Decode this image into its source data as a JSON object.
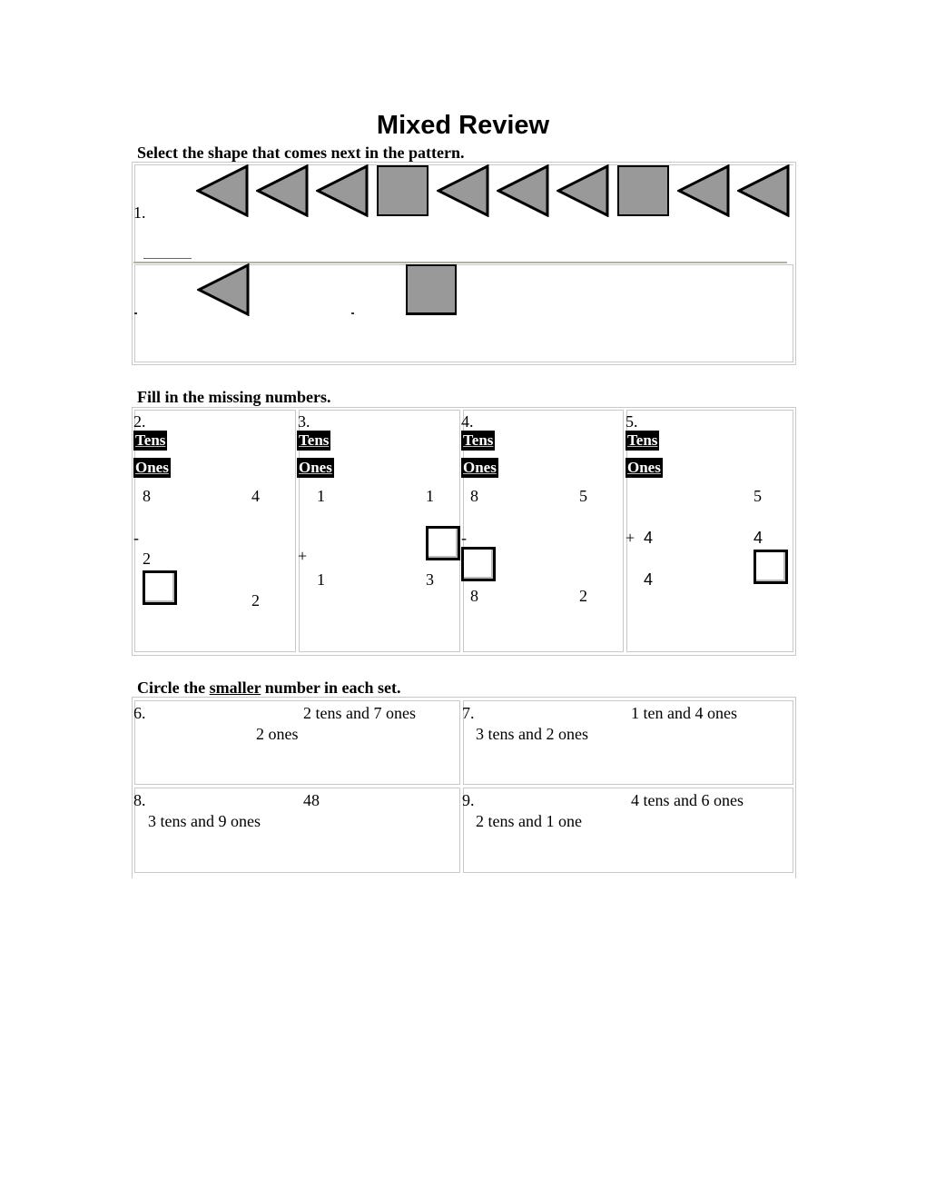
{
  "title": "Mixed Review",
  "sections": {
    "pattern": {
      "instruction": "Select the shape that comes next in the pattern.",
      "problem_number": "1.",
      "pattern_shapes": [
        "triangle-left-icon",
        "triangle-left-icon",
        "triangle-left-icon",
        "square-icon",
        "triangle-left-icon",
        "triangle-left-icon",
        "triangle-left-icon",
        "square-icon",
        "triangle-left-icon",
        "triangle-left-icon"
      ],
      "answer_blank": "",
      "choices": [
        "triangle-left-icon",
        "square-icon"
      ],
      "colors": {
        "shape_fill": "#999999",
        "shape_stroke": "#000000"
      }
    },
    "missing_numbers": {
      "instruction": "Fill in the missing numbers.",
      "tens_label": "Tens",
      "ones_label": "Ones",
      "problems": [
        {
          "number": "2.",
          "top_tens": "8",
          "top_ones": "4",
          "operator": "-",
          "second_tens": "2",
          "second_ones": "",
          "result_tens": "",
          "result_ones": "2"
        },
        {
          "number": "3.",
          "top_tens": "1",
          "top_ones": "1",
          "operator": "+",
          "second_tens": "",
          "second_ones": "",
          "result_tens": "1",
          "result_ones": "3"
        },
        {
          "number": "4.",
          "top_tens": "8",
          "top_ones": "5",
          "operator": "-",
          "second_tens": "",
          "second_ones": "",
          "result_tens": "8",
          "result_ones": "2"
        },
        {
          "number": "5.",
          "top_tens": "",
          "top_ones": "5",
          "operator": "+",
          "second_tens": "4",
          "second_ones": "4",
          "result_tens": "4",
          "result_ones": ""
        }
      ]
    },
    "compare": {
      "instruction_prefix": "Circle the ",
      "instruction_emphasis": "smaller",
      "instruction_suffix": " number in each set.",
      "problems": [
        {
          "number": "6.",
          "first": "2 tens and 7 ones",
          "second": "2 ones"
        },
        {
          "number": "7.",
          "first": "1 ten and 4 ones",
          "second": "3 tens and 2 ones"
        },
        {
          "number": "8.",
          "first": "48",
          "second": "3 tens and 9 ones"
        },
        {
          "number": "9.",
          "first": "4 tens and 6 ones",
          "second": "2 tens and 1 one"
        }
      ]
    }
  }
}
